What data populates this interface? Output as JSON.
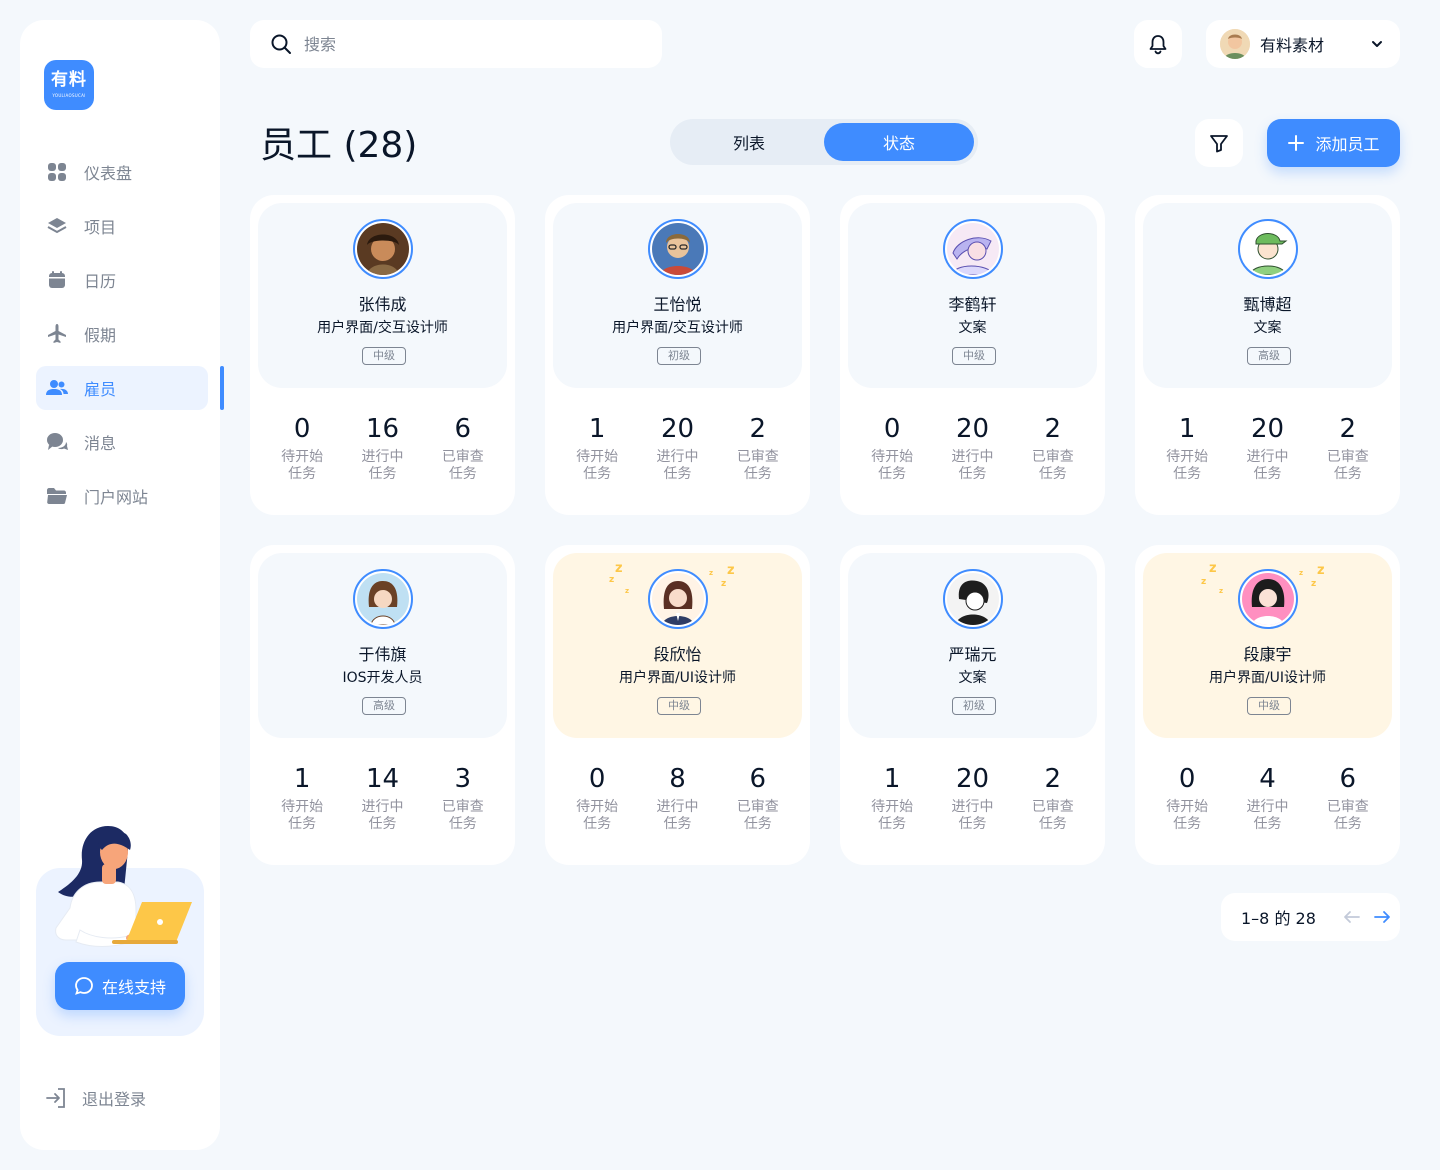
{
  "brand": {
    "logo_text": "有料",
    "logo_sub": "YOULIAOSUCAI"
  },
  "sidebar": {
    "items": [
      {
        "label": "仪表盘",
        "icon": "dashboard-icon"
      },
      {
        "label": "项目",
        "icon": "layers-icon"
      },
      {
        "label": "日历",
        "icon": "calendar-icon"
      },
      {
        "label": "假期",
        "icon": "airplane-icon"
      },
      {
        "label": "雇员",
        "icon": "users-icon",
        "active": true
      },
      {
        "label": "消息",
        "icon": "chat-icon"
      },
      {
        "label": "门户网站",
        "icon": "folder-icon"
      }
    ],
    "support_label": "在线支持",
    "logout_label": "退出登录"
  },
  "search": {
    "placeholder": "搜索",
    "value": ""
  },
  "profile": {
    "name": "有料素材"
  },
  "header": {
    "title": "员工 (28)",
    "view_toggle": [
      "列表",
      "状态"
    ],
    "active_view": "状态",
    "add_label": "添加员工"
  },
  "stat_labels": {
    "todo": "待开始任务",
    "doing": "进行中任务",
    "review": "已审查任务"
  },
  "employees": [
    {
      "name": "张伟成",
      "role": "用户界面/交互设计师",
      "level": "中级",
      "todo": "0",
      "doing": "16",
      "review": "6",
      "away": false
    },
    {
      "name": "王怡悦",
      "role": "用户界面/交互设计师",
      "level": "初级",
      "todo": "1",
      "doing": "20",
      "review": "2",
      "away": false
    },
    {
      "name": "李鹤轩",
      "role": "文案",
      "level": "中级",
      "todo": "0",
      "doing": "20",
      "review": "2",
      "away": false
    },
    {
      "name": "甄博超",
      "role": "文案",
      "level": "高级",
      "todo": "1",
      "doing": "20",
      "review": "2",
      "away": false
    },
    {
      "name": "于伟旗",
      "role": "IOS开发人员",
      "level": "高级",
      "todo": "1",
      "doing": "14",
      "review": "3",
      "away": false
    },
    {
      "name": "段欣怡",
      "role": "用户界面/UI设计师",
      "level": "中级",
      "todo": "0",
      "doing": "8",
      "review": "6",
      "away": true
    },
    {
      "name": "严瑞元",
      "role": "文案",
      "level": "初级",
      "todo": "1",
      "doing": "20",
      "review": "2",
      "away": false
    },
    {
      "name": "段康宇",
      "role": "用户界面/UI设计师",
      "level": "中级",
      "todo": "0",
      "doing": "4",
      "review": "6",
      "away": true
    }
  ],
  "pagination": {
    "text": "1–8 的 28"
  },
  "colors": {
    "accent": "#3f8cff",
    "text": "#0a1629",
    "muted": "#7d8592",
    "away": "#fff6e4",
    "sleep": "#fdc748"
  }
}
